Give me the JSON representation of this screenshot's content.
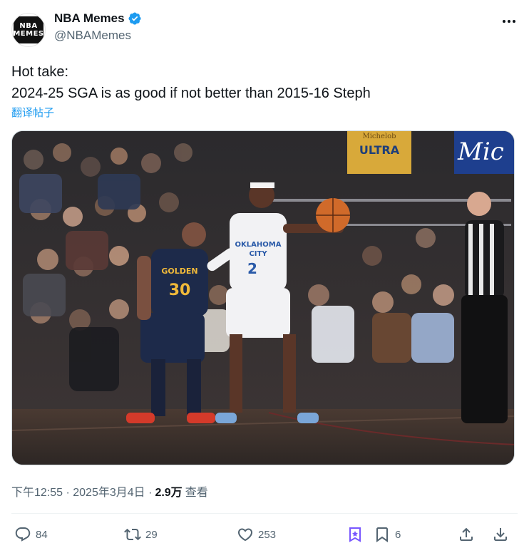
{
  "author": {
    "display_name": "NBA Memes",
    "handle": "@NBAMemes",
    "avatar_text_line1": "NBA",
    "avatar_text_line2": "MEMES",
    "verified": true
  },
  "tweet": {
    "line1": "Hot take:",
    "line2": "2024-25 SGA is as good if not better than 2015-16 Steph",
    "translate_label": "翻译帖子"
  },
  "media": {
    "description_icon": "photo",
    "jersey_left_text": "GOLDEN",
    "jersey_left_number": "30",
    "jersey_right_text_1": "OKLAHOMA",
    "jersey_right_text_2": "CITY",
    "jersey_right_number": "2",
    "banner_text": "ULTRA",
    "banner_top": "Michelob",
    "banner_right": "Mic"
  },
  "meta": {
    "time_date": "下午12:55 · 2025年3月4日 · ",
    "views": "2.9万",
    "views_label": "查看"
  },
  "actions": {
    "replies": "84",
    "reposts": "29",
    "likes": "253",
    "bookmarks": "6"
  },
  "colors": {
    "accent": "#1d9bf0",
    "muted": "#536471",
    "text": "#0f1419",
    "grok": "#7856ff"
  }
}
